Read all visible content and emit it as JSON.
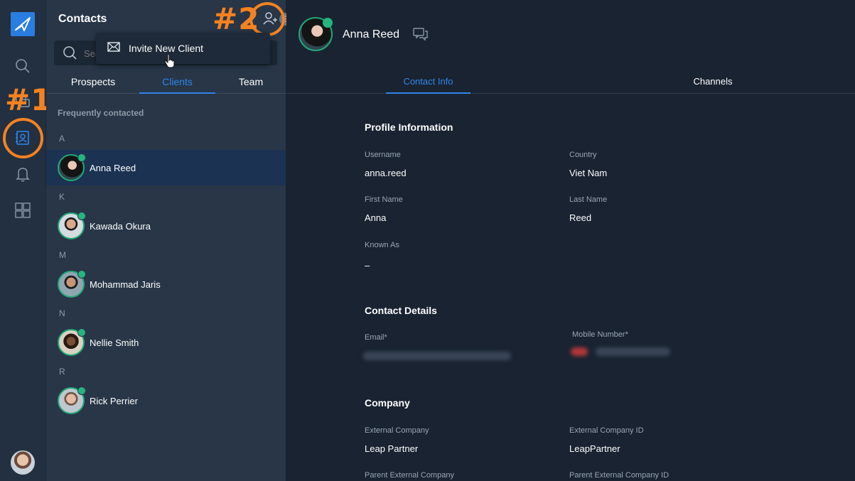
{
  "annotations": {
    "step1": "#1",
    "step2": "#2"
  },
  "colors": {
    "accent": "#2f86ea",
    "online": "#25b57f",
    "annotation": "#f58220"
  },
  "rail": {
    "icons": [
      "logo-icon",
      "search-icon",
      "chat-icon",
      "contacts-icon",
      "bell-icon",
      "apps-grid-icon"
    ]
  },
  "contacts_panel": {
    "title": "Contacts",
    "search_placeholder": "Search",
    "menu": {
      "invite_label": "Invite New Client"
    },
    "tabs": [
      "Prospects",
      "Clients",
      "Team"
    ],
    "active_tab": "Clients",
    "section_label": "Frequently contacted",
    "groups": [
      {
        "letter": "A",
        "contacts": [
          {
            "name": "Anna Reed",
            "selected": true
          }
        ]
      },
      {
        "letter": "K",
        "contacts": [
          {
            "name": "Kawada Okura"
          }
        ]
      },
      {
        "letter": "M",
        "contacts": [
          {
            "name": "Mohammad Jaris"
          }
        ]
      },
      {
        "letter": "N",
        "contacts": [
          {
            "name": "Nellie Smith"
          }
        ]
      },
      {
        "letter": "R",
        "contacts": [
          {
            "name": "Rick Perrier"
          }
        ]
      }
    ]
  },
  "detail": {
    "name": "Anna Reed",
    "tabs": [
      "Contact Info",
      "Channels"
    ],
    "active_tab": "Contact Info",
    "profile": {
      "heading": "Profile Information",
      "username_label": "Username",
      "username": "anna.reed",
      "country_label": "Country",
      "country": "Viet Nam",
      "first_name_label": "First Name",
      "first_name": "Anna",
      "last_name_label": "Last Name",
      "last_name": "Reed",
      "known_as_label": "Known As",
      "known_as": "–"
    },
    "contact_details": {
      "heading": "Contact Details",
      "email_label": "Email*",
      "mobile_label": "Mobile Number*"
    },
    "company": {
      "heading": "Company",
      "external_company_label": "External Company",
      "external_company": "Leap Partner",
      "external_company_id_label": "External Company ID",
      "external_company_id": "LeapPartner",
      "parent_external_company_label": "Parent External Company",
      "parent_external_company_id_label": "Parent External Company ID"
    }
  }
}
